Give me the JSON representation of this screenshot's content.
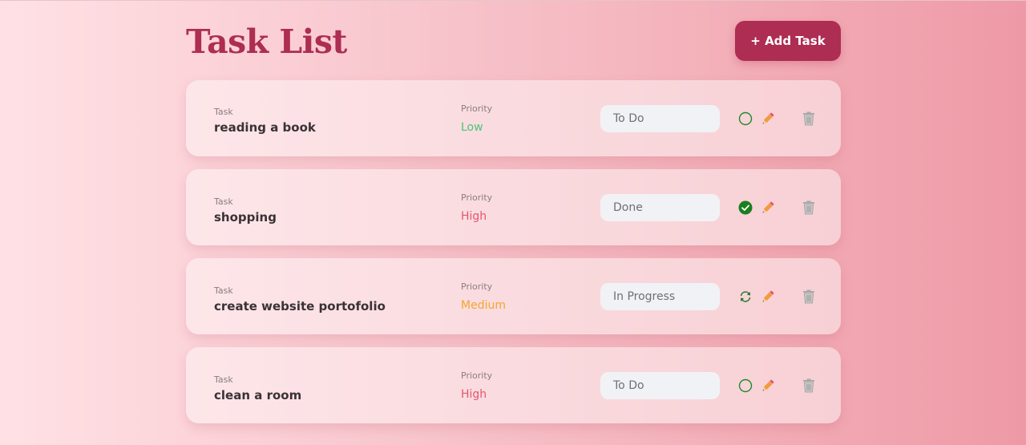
{
  "header": {
    "title": "Task List",
    "add_button": "+ Add Task"
  },
  "labels": {
    "task": "Task",
    "priority": "Priority"
  },
  "priority_colors": {
    "Low": "#48c774",
    "Medium": "#f3a530",
    "High": "#e8546d"
  },
  "tasks": [
    {
      "name": "reading a book",
      "priority": "Low",
      "status": "To Do",
      "status_icon": "empty-circle-icon"
    },
    {
      "name": "shopping",
      "priority": "High",
      "status": "Done",
      "status_icon": "check-circle-icon"
    },
    {
      "name": "create website portofolio",
      "priority": "Medium",
      "status": "In Progress",
      "status_icon": "refresh-icon"
    },
    {
      "name": "clean a room",
      "priority": "High",
      "status": "To Do",
      "status_icon": "empty-circle-icon"
    }
  ]
}
